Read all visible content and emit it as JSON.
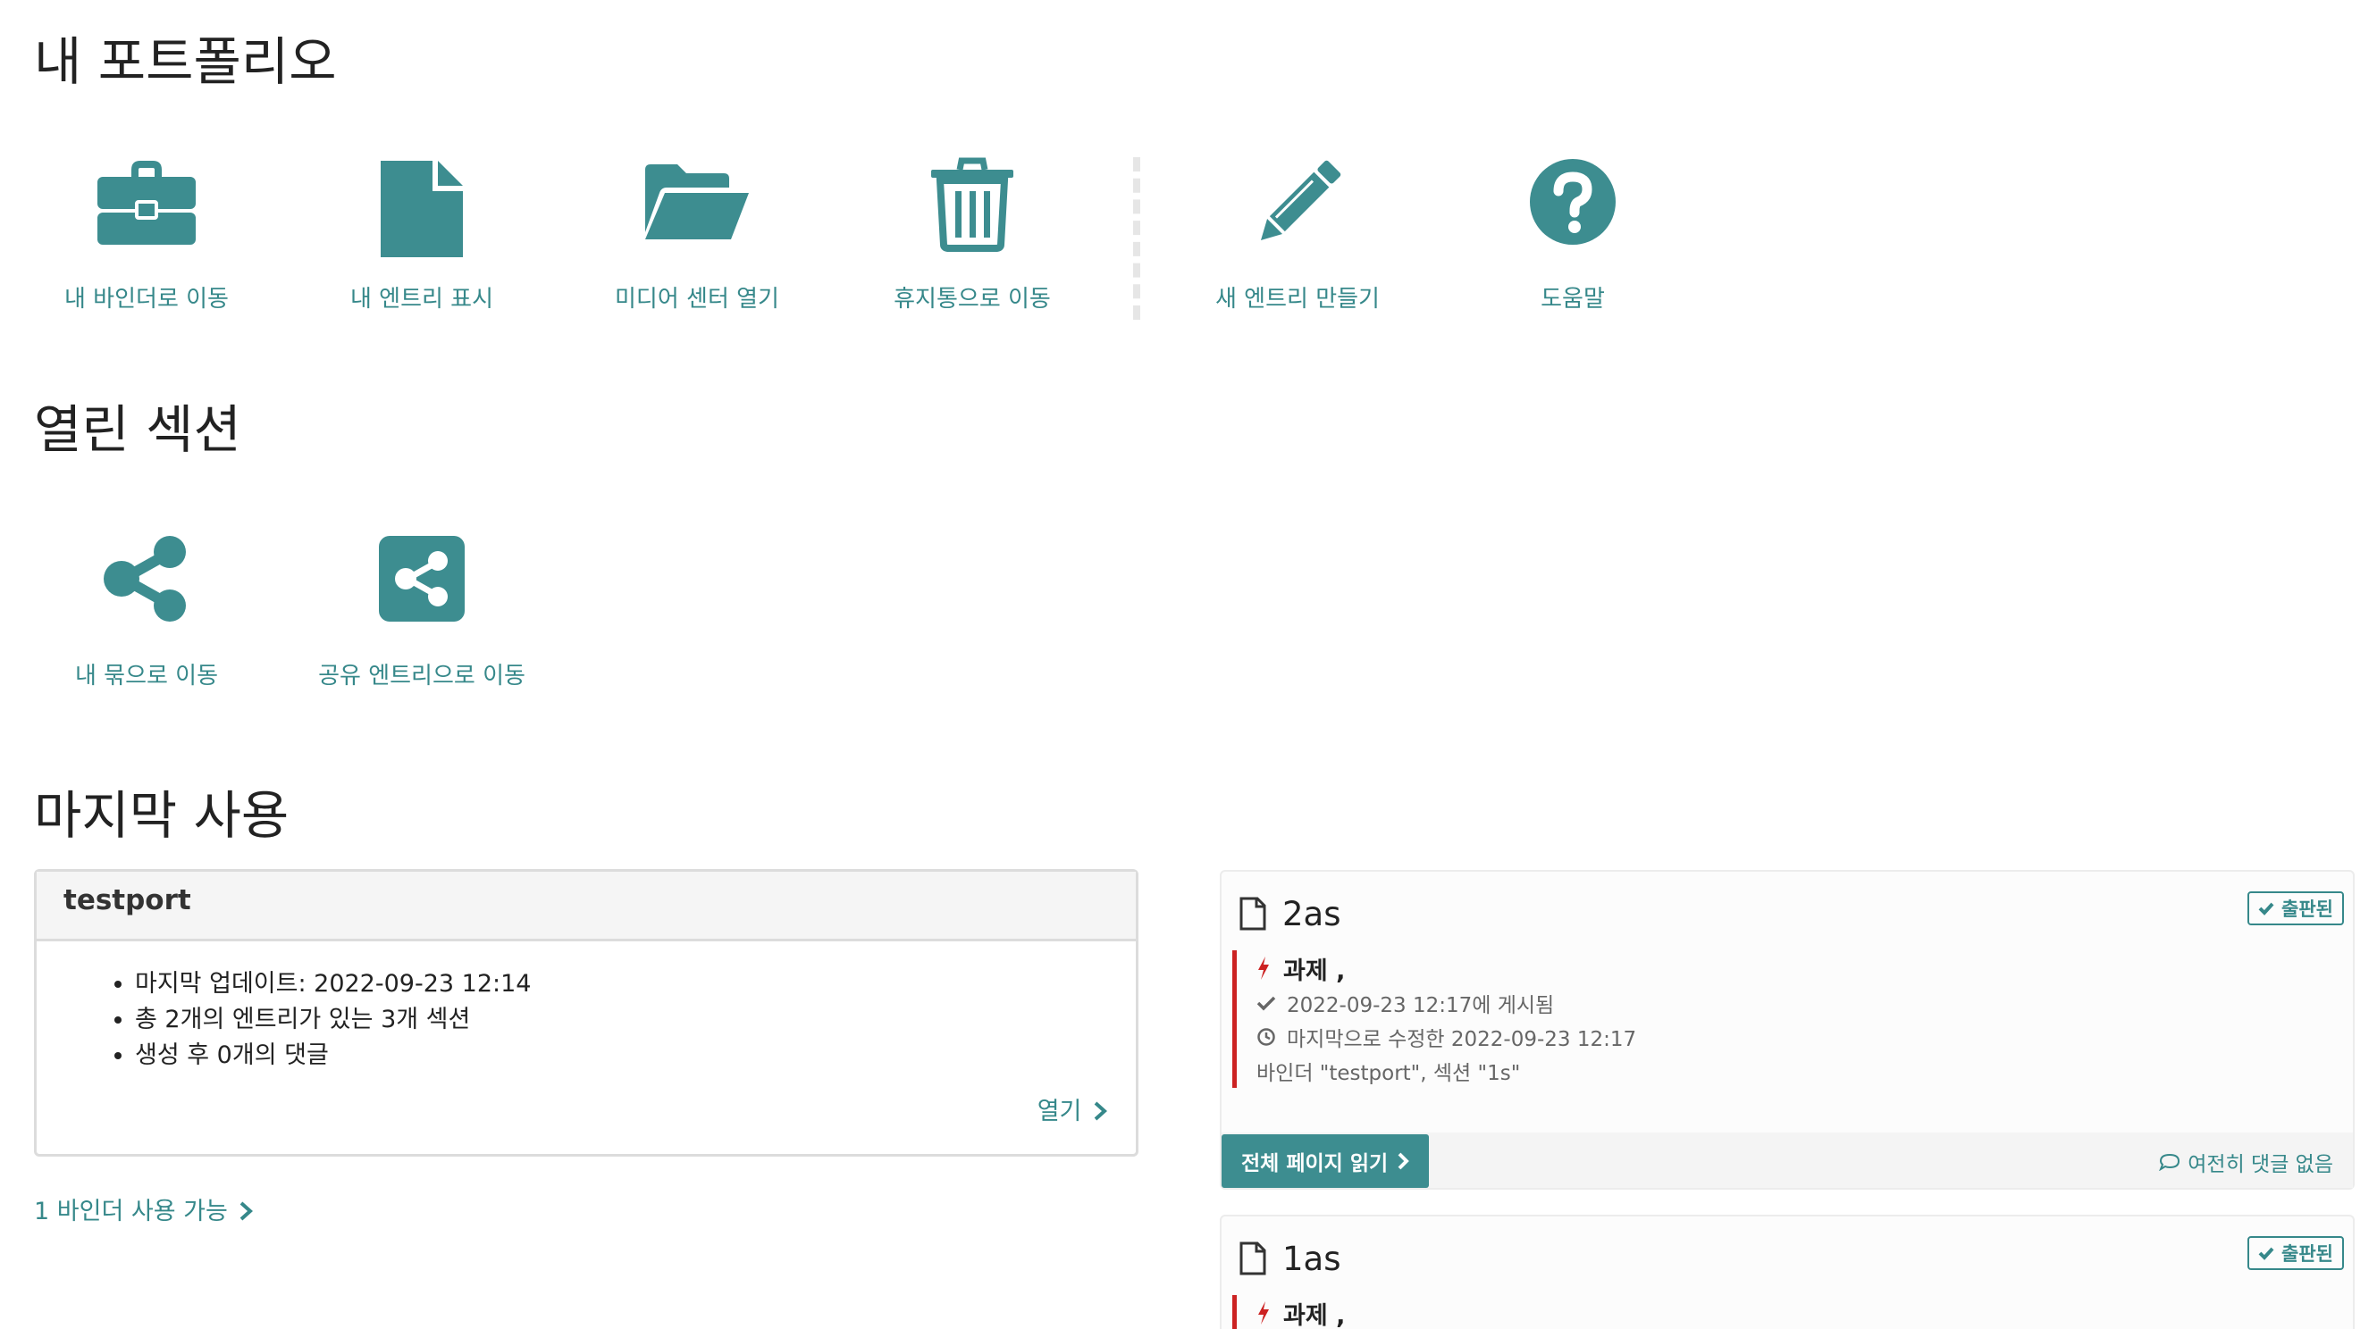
{
  "sections": {
    "portfolio_title": "내 포트폴리오",
    "open_sections_title": "열린 섹션",
    "last_used_title": "마지막 사용"
  },
  "portfolio_actions": [
    {
      "label": "내 바인더로 이동",
      "icon": "briefcase-icon"
    },
    {
      "label": "내 엔트리 표시",
      "icon": "file-icon"
    },
    {
      "label": "미디어 센터 열기",
      "icon": "folder-open-icon"
    },
    {
      "label": "휴지통으로 이동",
      "icon": "trash-icon"
    },
    {
      "label": "새 엔트리 만들기",
      "icon": "pencil-icon"
    },
    {
      "label": "도움말",
      "icon": "question-circle-icon"
    }
  ],
  "open_section_actions": [
    {
      "label": "내 묶으로 이동",
      "icon": "share-icon"
    },
    {
      "label": "공유 엔트리으로 이동",
      "icon": "share-square-icon"
    }
  ],
  "binder": {
    "name": "testport",
    "details": [
      "마지막 업데이트: 2022-09-23 12:14",
      "총 2개의 엔트리가 있는 3개 섹션",
      "생성 후 0개의 댓글"
    ],
    "open_label": "열기",
    "available_label": "1 바인더 사용 가능"
  },
  "entries": [
    {
      "title": "2as",
      "status": "출판된",
      "type": "과제 ,",
      "posted": "2022-09-23 12:17에 게시됨",
      "modified": "마지막으로 수정한 2022-09-23 12:17",
      "location": "바인더 \"testport\", 섹션 \"1s\"",
      "read_label": "전체 페이지 읽기",
      "comments": "여전히 댓글 없음"
    },
    {
      "title": "1as",
      "status": "출판된",
      "type": "과제 ,"
    }
  ],
  "colors": {
    "accent": "#3d8d90",
    "link": "#36888a",
    "entry_bar": "#cc2222",
    "type_icon": "#cc2222"
  }
}
